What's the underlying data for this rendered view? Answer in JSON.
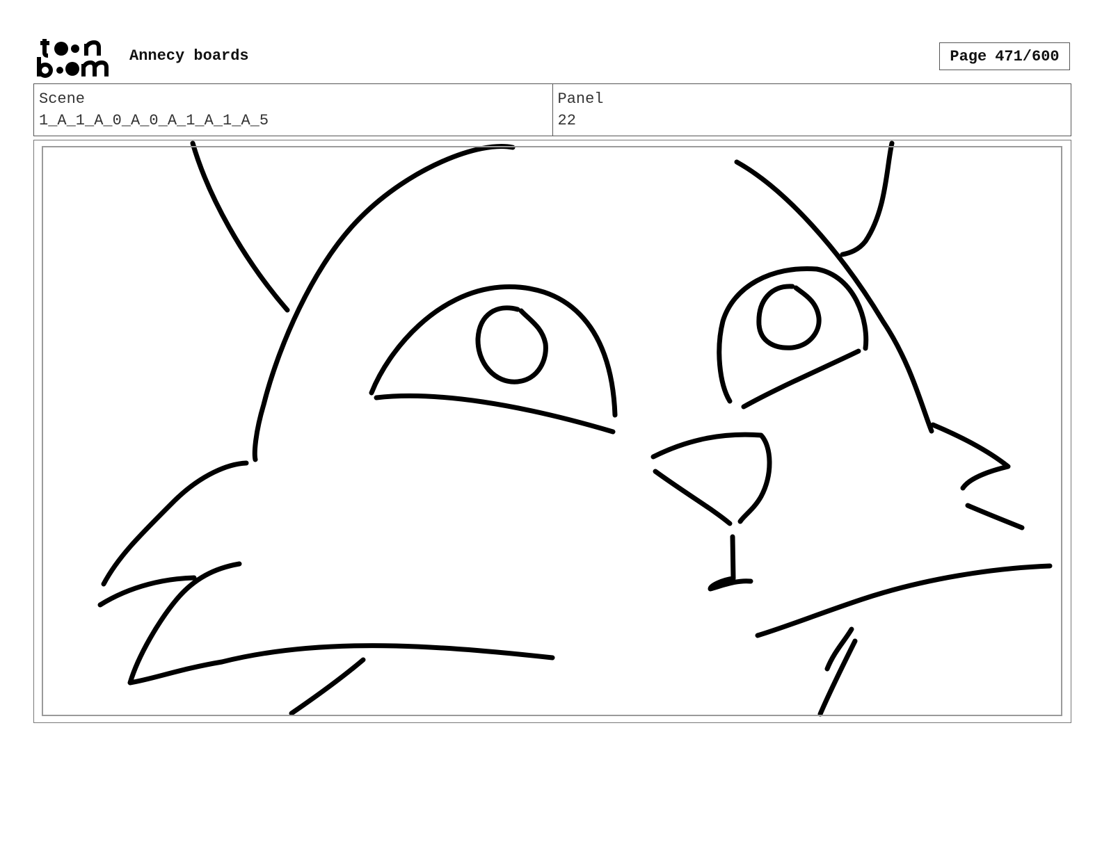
{
  "header": {
    "logo_text": "toon boom",
    "app_title": "Annecy boards",
    "page_label": "Page",
    "page_value": "471/600"
  },
  "info": {
    "scene_label": "Scene",
    "scene_value": "1_A_1_A_0_A_0_A_1_A_1_A_5",
    "panel_label": "Panel",
    "panel_value": "22"
  }
}
